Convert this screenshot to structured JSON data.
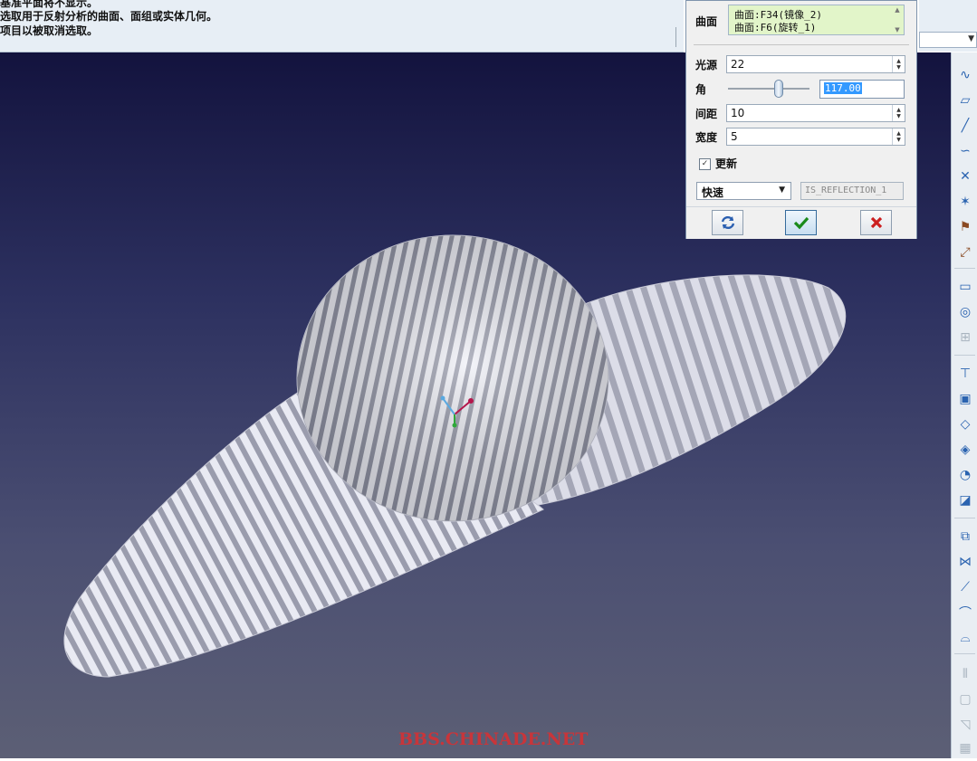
{
  "messages": [
    "基准平面将不显示。",
    "选取用于反射分析的曲面、面组或实体几何。",
    "项目以被取消选取。"
  ],
  "dialog": {
    "surface_label": "曲面",
    "surfaces": [
      "曲面:F34(镜像_2)",
      "曲面:F6(旋转_1)"
    ],
    "light_source_label": "光源",
    "light_source_value": "22",
    "angle_label": "角",
    "angle_value": "117.00",
    "angle_slider_fraction": 0.62,
    "spacing_label": "间距",
    "spacing_value": "10",
    "width_label": "宽度",
    "width_value": "5",
    "update_label": "更新",
    "update_checked": true,
    "mode_value": "快速",
    "result_name": "IS_REFLECTION_1",
    "buttons": {
      "refresh": "refresh-icon",
      "ok": "check-icon",
      "cancel": "close-icon"
    }
  },
  "watermark": "BBS.CHINADE.NET",
  "colors": {
    "viewport_top": "#13133e",
    "viewport_bottom": "#5c5f75",
    "ok_green": "#1a8a1a",
    "cancel_red": "#cc1f1f",
    "watermark": "#c8353a"
  }
}
